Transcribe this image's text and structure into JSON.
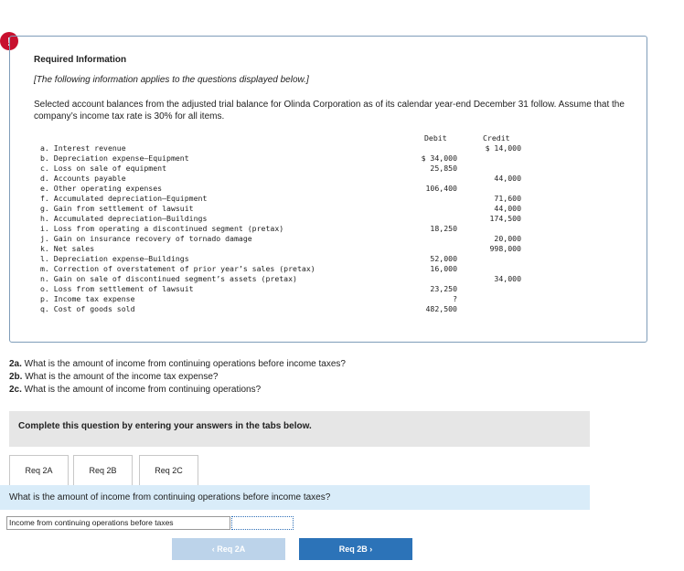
{
  "alert": {
    "symbol": "!"
  },
  "info": {
    "title": "Required Information",
    "note": "[The following information applies to the questions displayed below.]",
    "description": "Selected account balances from the adjusted trial balance for Olinda Corporation as of its calendar year-end December 31 follow. Assume that the company’s income tax rate is 30% for all items."
  },
  "table": {
    "debit_header": "Debit",
    "credit_header": "Credit",
    "accounts": [
      "a. Interest revenue",
      "b. Depreciation expense—Equipment",
      "c. Loss on sale of equipment",
      "d. Accounts payable",
      "e. Other operating expenses",
      "f. Accumulated depreciation—Equipment",
      "g. Gain from settlement of lawsuit",
      "h. Accumulated depreciation—Buildings",
      "i. Loss from operating a discontinued segment (pretax)",
      "j. Gain on insurance recovery of tornado damage",
      "k. Net sales",
      "l. Depreciation expense—Buildings",
      "m. Correction of overstatement of prior year’s sales (pretax)",
      "n. Gain on sale of discontinued segment’s assets (pretax)",
      "o. Loss from settlement of lawsuit",
      "p. Income tax expense",
      "q. Cost of goods sold"
    ],
    "debits": [
      "$ 34,000",
      "25,850",
      "",
      "106,400",
      "",
      "",
      "",
      "18,250",
      "",
      "",
      "52,000",
      "16,000",
      "",
      "23,250",
      "?",
      "482,500"
    ],
    "credits": [
      "$ 14,000",
      "",
      "",
      "44,000",
      "",
      "71,600",
      "44,000",
      "174,500",
      "",
      "20,000",
      "998,000",
      "",
      "",
      "34,000"
    ]
  },
  "questions": {
    "q2a_num": "2a.",
    "q2a": " What is the amount of income from continuing operations before income taxes?",
    "q2b_num": "2b.",
    "q2b": " What is the amount of the income tax expense?",
    "q2c_num": "2c.",
    "q2c": " What is the amount of income from continuing operations?"
  },
  "instruction": "Complete this question by entering your answers in the tabs below.",
  "tabs": [
    {
      "label": "Req 2A"
    },
    {
      "label": "Req 2B"
    },
    {
      "label": "Req 2C"
    }
  ],
  "active_question": "What is the amount of income from continuing operations before income taxes?",
  "answer": {
    "label": "Income from continuing operations before taxes",
    "value": ""
  },
  "nav": {
    "prev_label": "‹ Req 2A",
    "next_label": "Req 2B ›"
  }
}
